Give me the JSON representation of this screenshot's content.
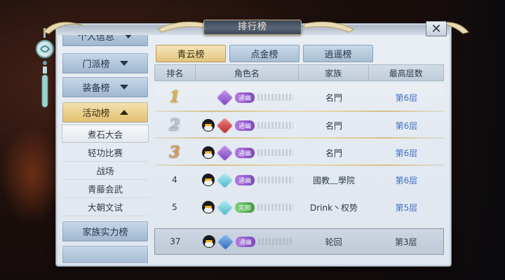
{
  "window": {
    "title": "排行榜",
    "close_icon": "close-icon"
  },
  "sidebar": {
    "categories": [
      {
        "label": "个人信息",
        "state": "collapsed"
      },
      {
        "label": "门派榜",
        "state": "collapsed"
      },
      {
        "label": "装备榜",
        "state": "collapsed"
      },
      {
        "label": "活动榜",
        "state": "expanded"
      },
      {
        "label": "家族实力榜",
        "state": "collapsed"
      }
    ],
    "sub_items": [
      {
        "label": "煮石大会",
        "selected": true
      },
      {
        "label": "轻功比赛",
        "selected": false
      },
      {
        "label": "战场",
        "selected": false
      },
      {
        "label": "青藤会武",
        "selected": false
      },
      {
        "label": "大朝文试",
        "selected": false
      }
    ]
  },
  "tabs": [
    {
      "label": "青云榜",
      "active": true
    },
    {
      "label": "点金榜",
      "active": false
    },
    {
      "label": "逍遥榜",
      "active": false
    }
  ],
  "table": {
    "headers": [
      "排名",
      "角色名",
      "家族",
      "最高层数"
    ],
    "rows": [
      {
        "rank": "1",
        "job": "purple",
        "badge": "通幽",
        "badge_color": "purple",
        "family": "名門",
        "floor": "第6层"
      },
      {
        "rank": "2",
        "job": "red",
        "badge": "通幽",
        "badge_color": "purple",
        "family": "名門",
        "floor": "第6层"
      },
      {
        "rank": "3",
        "job": "purple",
        "badge": "通幽",
        "badge_color": "purple",
        "family": "名門",
        "floor": "第6层"
      },
      {
        "rank": "4",
        "job": "cyan",
        "badge": "通幽",
        "badge_color": "purple",
        "family": "國教﹏學院",
        "floor": "第6层"
      },
      {
        "rank": "5",
        "job": "cyan",
        "badge": "完颜",
        "badge_color": "green",
        "family": "Drink丶权势",
        "floor": "第5层"
      }
    ],
    "self_row": {
      "rank": "37",
      "job": "blue",
      "badge": "通幽",
      "badge_color": "purple",
      "family": "轮回",
      "floor": "第3层"
    }
  },
  "colors": {
    "tab_active": "#e1c47e",
    "tab_inactive": "#a7bdd3",
    "floor_text": "#3f6fc0",
    "badge_purple": "#7c47bd",
    "badge_green": "#3e9a3d"
  }
}
